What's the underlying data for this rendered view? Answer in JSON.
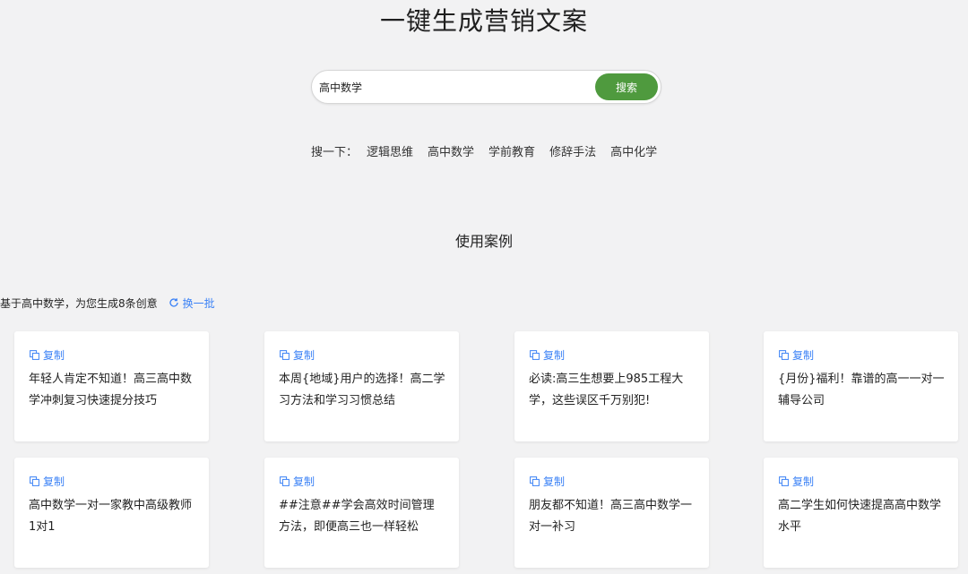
{
  "header": {
    "title": "一键生成营销文案"
  },
  "search": {
    "value": "高中数学",
    "button_label": "搜索"
  },
  "quick_search": {
    "label": "搜一下：",
    "tags": [
      "逻辑思维",
      "高中数学",
      "学前教育",
      "修辞手法",
      "高中化学"
    ]
  },
  "section": {
    "title": "使用案例"
  },
  "generator": {
    "summary": "基于高中数学，为您生成8条创意",
    "refresh_label": "换一批"
  },
  "cards": [
    {
      "copy_label": "复制",
      "text": "年轻人肯定不知道！高三高中数学冲刺复习快速提分技巧"
    },
    {
      "copy_label": "复制",
      "text": "本周{地域}用户的选择！高二学习方法和学习习惯总结"
    },
    {
      "copy_label": "复制",
      "text": "必读:高三生想要上985工程大学，这些误区千万别犯!"
    },
    {
      "copy_label": "复制",
      "text": "{月份}福利！靠谱的高一一对一辅导公司"
    },
    {
      "copy_label": "复制",
      "text": "高中数学一对一家教中高级教师1对1"
    },
    {
      "copy_label": "复制",
      "text": "##注意##学会高效时间管理方法，即便高三也一样轻松"
    },
    {
      "copy_label": "复制",
      "text": "朋友都不知道！高三高中数学一对一补习"
    },
    {
      "copy_label": "复制",
      "text": "高二学生如何快速提高高中数学水平"
    }
  ],
  "colors": {
    "accent_green": "#4f9a3e",
    "link_blue": "#3b82f6",
    "background": "#f2f2f3"
  },
  "icons": {
    "copy": "copy-icon",
    "refresh": "refresh-icon"
  }
}
